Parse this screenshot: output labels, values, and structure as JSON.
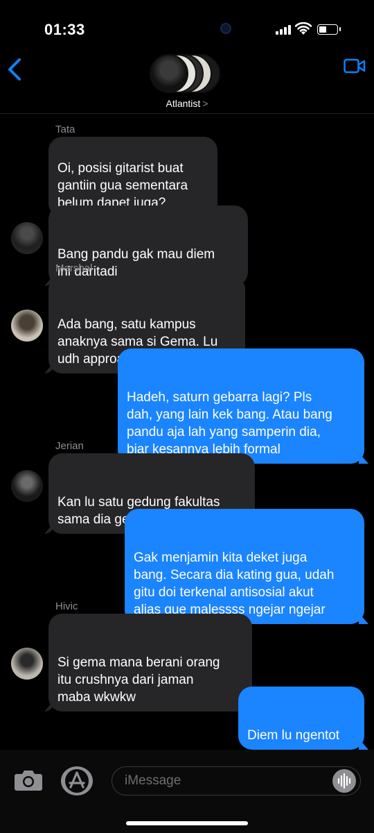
{
  "status": {
    "time": "01:33"
  },
  "header": {
    "group_name": "Atlantist",
    "chevron": ">"
  },
  "messages": [
    {
      "sender": "Tata",
      "text": "Oi, posisi gitarist buat\ngantiin gua sementara\nbelum dapet juga?"
    },
    {
      "text": "Bang pandu gak mau diem\nini daritadi"
    },
    {
      "sender": "Marshal",
      "text": "Ada bang, satu kampus\nanaknya sama si Gema. Lu\nudh approach blm gem?"
    },
    {
      "text": "Hadeh, saturn gebarra lagi? Pls\ndah, yang lain kek bang. Atau bang\npandu aja lah yang samperin dia,\nbiar kesannya lebih formal"
    },
    {
      "sender": "Jerian",
      "text": "Kan lu satu gedung fakultas\nsama dia gem"
    },
    {
      "text": "Gak menjamin kita deket juga\nbang. Secara dia kating gua, udah\ngitu doi terkenal antisosial akut\nalias gue malessss ngejar ngejar"
    },
    {
      "sender": "Hivic",
      "text": "Si gema mana berani orang\nitu crushnya dari jaman\nmaba wkwkw"
    },
    {
      "text": "Diem lu ngentot"
    }
  ],
  "composer": {
    "placeholder": "iMessage"
  },
  "colors": {
    "outgoing": "#1b84ff",
    "incoming": "#262628",
    "accent": "#0a84ff"
  }
}
